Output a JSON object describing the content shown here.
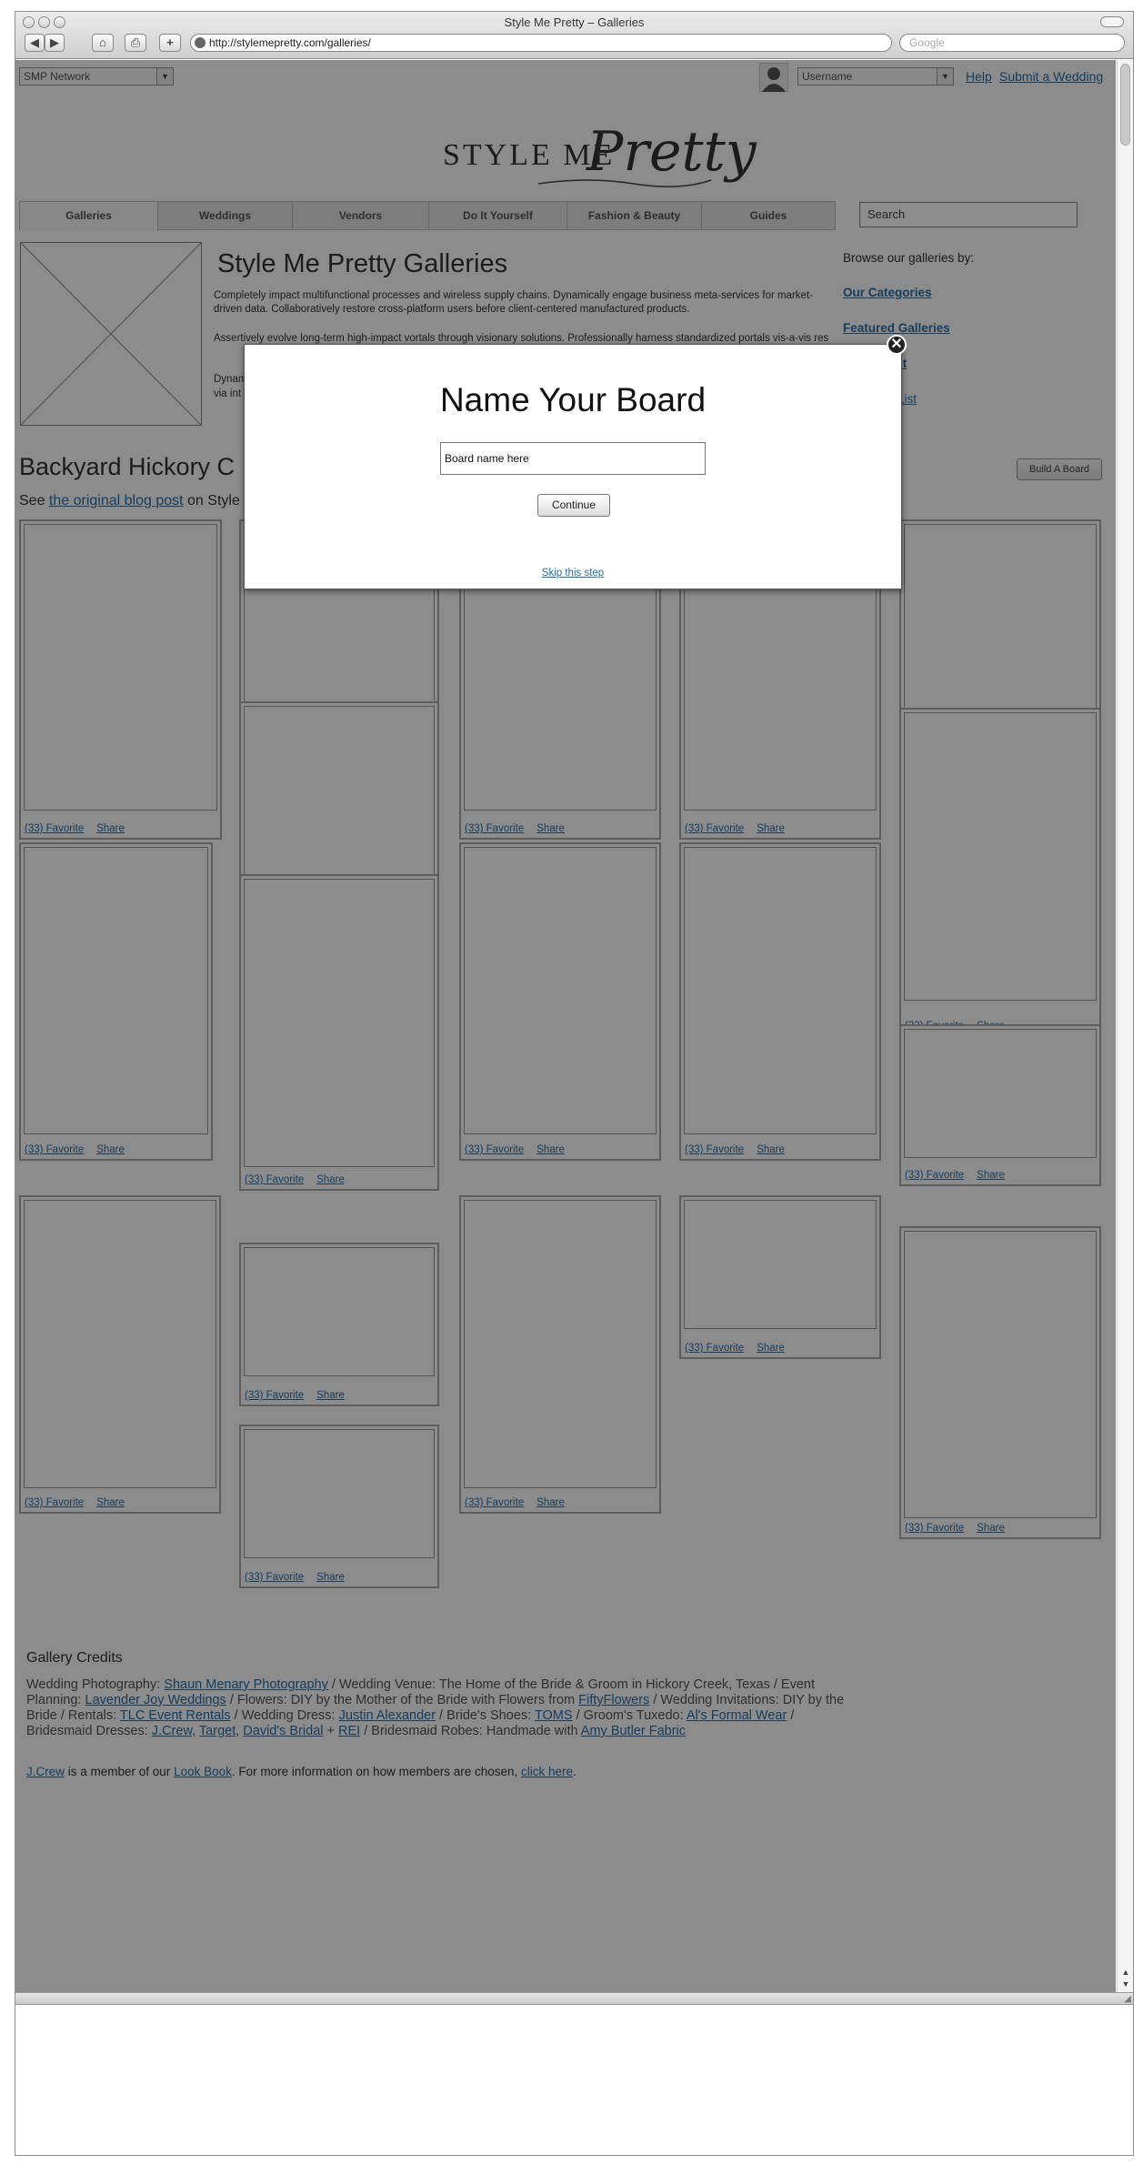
{
  "window": {
    "title": "Style Me Pretty – Galleries"
  },
  "browser": {
    "back": "◀",
    "forward": "▶",
    "home": "⌂",
    "print": "⎙",
    "add": "+",
    "url": "http://stylemepretty.com/galleries/",
    "search_placeholder": "Google"
  },
  "topbar": {
    "network": "SMP Network",
    "username": "Username",
    "help": "Help",
    "submit": "Submit a Wedding"
  },
  "logo": {
    "text": "STYLE ME",
    "script": "Pretty"
  },
  "nav": {
    "tabs": [
      "Galleries",
      "Weddings",
      "Vendors",
      "Do It Yourself",
      "Fashion & Beauty",
      "Guides"
    ],
    "active": "Galleries",
    "search": "Search"
  },
  "intro": {
    "title": "Style Me Pretty Galleries",
    "p1": "Completely impact multifunctional processes and wireless supply chains. Dynamically engage business meta-services for market-driven data. Collaboratively restore cross-platform users before client-centered manufactured products.",
    "p2": "Assertively evolve long-term high-impact vortals through visionary solutions. Professionally harness standardized portals vis-a-vis res",
    "p3a": "Dynam",
    "p3b": "via int"
  },
  "sidebar": {
    "heading": "Browse our galleries by:",
    "links": [
      "Our Categories",
      "Featured Galleries",
      "ent",
      "List"
    ]
  },
  "board": {
    "title": "Backyard Hickory C",
    "see": "See ",
    "post_link": "the original blog post",
    "on": " on Style",
    "build": "Build A Board"
  },
  "card": {
    "favorite": "(33) Favorite",
    "share": "Share"
  },
  "credits": {
    "title": "Gallery Credits",
    "t1": "Wedding Photography: ",
    "l1": "Shaun Menary Photography",
    "t2": " / Wedding Venue: The Home of the Bride & Groom in Hickory Creek, Texas / Event Planning: ",
    "l2": "Lavender Joy Weddings",
    "t3": " / Flowers: DIY by the Mother of the Bride with Flowers from ",
    "l3": "FiftyFlowers",
    "t4": " / Wedding Invitations: DIY by the Bride / Rentals: ",
    "l4": "TLC Event Rentals",
    "t5": " / Wedding Dress: ",
    "l5": "Justin Alexander",
    "t6": " / Bride's Shoes: ",
    "l6": "TOMS",
    "t7": " / Groom's Tuxedo: ",
    "l7": "Al's Formal Wear",
    "t8": " / Bridesmaid Dresses: ",
    "l8": "J.Crew",
    "t9": ", ",
    "l9": "Target",
    "t10": ", ",
    "l10": "David's Bridal",
    "t11": " + ",
    "l11": "REI",
    "t12": " / Bridesmaid Robes: Handmade with ",
    "l12": "Amy Butler Fabric",
    "m_link1": "J.Crew",
    "m_t1": " is a member of our ",
    "m_link2": "Look Book",
    "m_t2": ". For more information on how members are chosen, ",
    "m_link3": "click here",
    "m_t3": "."
  },
  "modal": {
    "title": "Name Your Board",
    "input_value": "Board name here",
    "continue": "Continue",
    "skip": "Skip this step",
    "close": "✕"
  }
}
